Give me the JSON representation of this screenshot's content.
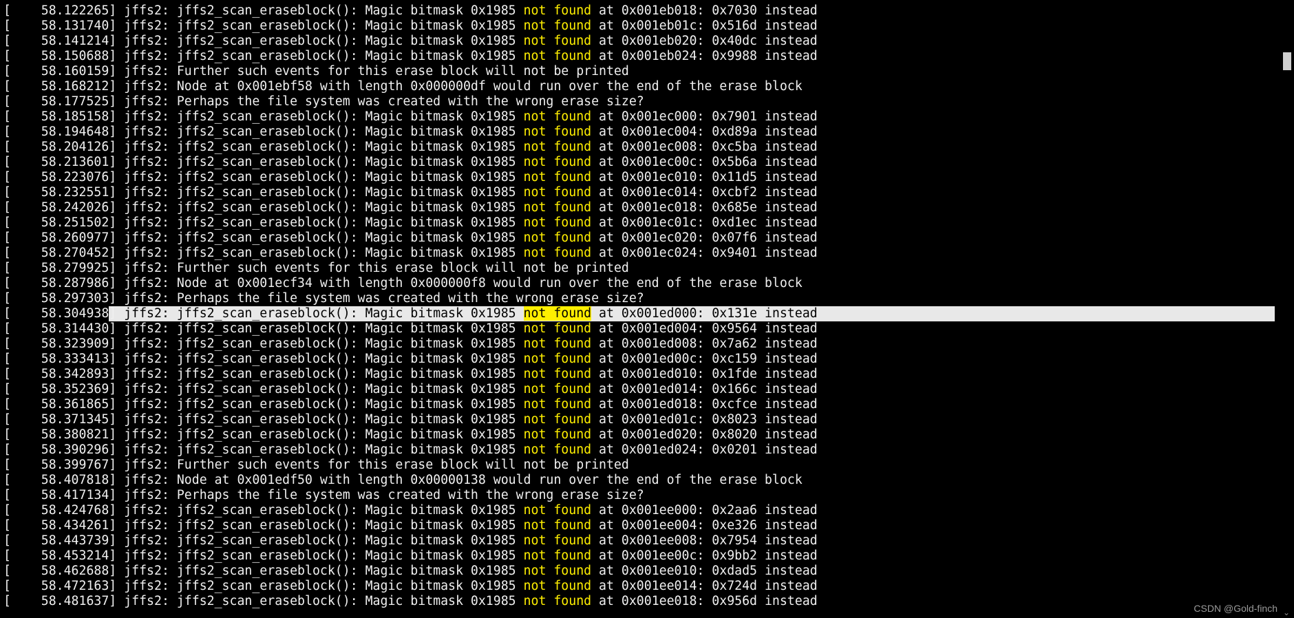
{
  "colors": {
    "background": "#000000",
    "text": "#f0f0f0",
    "highlight": "#ffef00",
    "selection": "#e8e8e8"
  },
  "highlight_word": "not found",
  "lines": [
    {
      "ts": "[    58.122265]",
      "msg": " jffs2: jffs2_scan_eraseblock(): Magic bitmask 0x1985 not found at 0x001eb018: 0x7030 instead"
    },
    {
      "ts": "[    58.131740]",
      "msg": " jffs2: jffs2_scan_eraseblock(): Magic bitmask 0x1985 not found at 0x001eb01c: 0x516d instead"
    },
    {
      "ts": "[    58.141214]",
      "msg": " jffs2: jffs2_scan_eraseblock(): Magic bitmask 0x1985 not found at 0x001eb020: 0x40dc instead"
    },
    {
      "ts": "[    58.150688]",
      "msg": " jffs2: jffs2_scan_eraseblock(): Magic bitmask 0x1985 not found at 0x001eb024: 0x9988 instead"
    },
    {
      "ts": "[    58.160159]",
      "msg": " jffs2: Further such events for this erase block will not be printed"
    },
    {
      "ts": "[    58.168212]",
      "msg": " jffs2: Node at 0x001ebf58 with length 0x000000df would run over the end of the erase block"
    },
    {
      "ts": "[    58.177525]",
      "msg": " jffs2: Perhaps the file system was created with the wrong erase size?"
    },
    {
      "ts": "[    58.185158]",
      "msg": " jffs2: jffs2_scan_eraseblock(): Magic bitmask 0x1985 not found at 0x001ec000: 0x7901 instead"
    },
    {
      "ts": "[    58.194648]",
      "msg": " jffs2: jffs2_scan_eraseblock(): Magic bitmask 0x1985 not found at 0x001ec004: 0xd89a instead"
    },
    {
      "ts": "[    58.204126]",
      "msg": " jffs2: jffs2_scan_eraseblock(): Magic bitmask 0x1985 not found at 0x001ec008: 0xc5ba instead"
    },
    {
      "ts": "[    58.213601]",
      "msg": " jffs2: jffs2_scan_eraseblock(): Magic bitmask 0x1985 not found at 0x001ec00c: 0x5b6a instead"
    },
    {
      "ts": "[    58.223076]",
      "msg": " jffs2: jffs2_scan_eraseblock(): Magic bitmask 0x1985 not found at 0x001ec010: 0x11d5 instead"
    },
    {
      "ts": "[    58.232551]",
      "msg": " jffs2: jffs2_scan_eraseblock(): Magic bitmask 0x1985 not found at 0x001ec014: 0xcbf2 instead"
    },
    {
      "ts": "[    58.242026]",
      "msg": " jffs2: jffs2_scan_eraseblock(): Magic bitmask 0x1985 not found at 0x001ec018: 0x685e instead"
    },
    {
      "ts": "[    58.251502]",
      "msg": " jffs2: jffs2_scan_eraseblock(): Magic bitmask 0x1985 not found at 0x001ec01c: 0xd1ec instead"
    },
    {
      "ts": "[    58.260977]",
      "msg": " jffs2: jffs2_scan_eraseblock(): Magic bitmask 0x1985 not found at 0x001ec020: 0x07f6 instead"
    },
    {
      "ts": "[    58.270452]",
      "msg": " jffs2: jffs2_scan_eraseblock(): Magic bitmask 0x1985 not found at 0x001ec024: 0x9401 instead"
    },
    {
      "ts": "[    58.279925]",
      "msg": " jffs2: Further such events for this erase block will not be printed"
    },
    {
      "ts": "[    58.287986]",
      "msg": " jffs2: Node at 0x001ecf34 with length 0x000000f8 would run over the end of the erase block"
    },
    {
      "ts": "[    58.297303]",
      "msg": " jffs2: Perhaps the file system was created with the wrong erase size?"
    },
    {
      "ts": "[    58.304938]",
      "msg": " jffs2: jffs2_scan_eraseblock(): Magic bitmask 0x1985 not found at 0x001ed000: 0x131e instead",
      "selected": true
    },
    {
      "ts": "[    58.314430]",
      "msg": " jffs2: jffs2_scan_eraseblock(): Magic bitmask 0x1985 not found at 0x001ed004: 0x9564 instead"
    },
    {
      "ts": "[    58.323909]",
      "msg": " jffs2: jffs2_scan_eraseblock(): Magic bitmask 0x1985 not found at 0x001ed008: 0x7a62 instead"
    },
    {
      "ts": "[    58.333413]",
      "msg": " jffs2: jffs2_scan_eraseblock(): Magic bitmask 0x1985 not found at 0x001ed00c: 0xc159 instead"
    },
    {
      "ts": "[    58.342893]",
      "msg": " jffs2: jffs2_scan_eraseblock(): Magic bitmask 0x1985 not found at 0x001ed010: 0x1fde instead"
    },
    {
      "ts": "[    58.352369]",
      "msg": " jffs2: jffs2_scan_eraseblock(): Magic bitmask 0x1985 not found at 0x001ed014: 0x166c instead"
    },
    {
      "ts": "[    58.361865]",
      "msg": " jffs2: jffs2_scan_eraseblock(): Magic bitmask 0x1985 not found at 0x001ed018: 0xcfce instead"
    },
    {
      "ts": "[    58.371345]",
      "msg": " jffs2: jffs2_scan_eraseblock(): Magic bitmask 0x1985 not found at 0x001ed01c: 0x8023 instead"
    },
    {
      "ts": "[    58.380821]",
      "msg": " jffs2: jffs2_scan_eraseblock(): Magic bitmask 0x1985 not found at 0x001ed020: 0x8020 instead"
    },
    {
      "ts": "[    58.390296]",
      "msg": " jffs2: jffs2_scan_eraseblock(): Magic bitmask 0x1985 not found at 0x001ed024: 0x0201 instead"
    },
    {
      "ts": "[    58.399767]",
      "msg": " jffs2: Further such events for this erase block will not be printed"
    },
    {
      "ts": "[    58.407818]",
      "msg": " jffs2: Node at 0x001edf50 with length 0x00000138 would run over the end of the erase block"
    },
    {
      "ts": "[    58.417134]",
      "msg": " jffs2: Perhaps the file system was created with the wrong erase size?"
    },
    {
      "ts": "[    58.424768]",
      "msg": " jffs2: jffs2_scan_eraseblock(): Magic bitmask 0x1985 not found at 0x001ee000: 0x2aa6 instead"
    },
    {
      "ts": "[    58.434261]",
      "msg": " jffs2: jffs2_scan_eraseblock(): Magic bitmask 0x1985 not found at 0x001ee004: 0xe326 instead"
    },
    {
      "ts": "[    58.443739]",
      "msg": " jffs2: jffs2_scan_eraseblock(): Magic bitmask 0x1985 not found at 0x001ee008: 0x7954 instead"
    },
    {
      "ts": "[    58.453214]",
      "msg": " jffs2: jffs2_scan_eraseblock(): Magic bitmask 0x1985 not found at 0x001ee00c: 0x9bb2 instead"
    },
    {
      "ts": "[    58.462688]",
      "msg": " jffs2: jffs2_scan_eraseblock(): Magic bitmask 0x1985 not found at 0x001ee010: 0xdad5 instead"
    },
    {
      "ts": "[    58.472163]",
      "msg": " jffs2: jffs2_scan_eraseblock(): Magic bitmask 0x1985 not found at 0x001ee014: 0x724d instead"
    },
    {
      "ts": "[    58.481637]",
      "msg": " jffs2: jffs2_scan_eraseblock(): Magic bitmask 0x1985 not found at 0x001ee018: 0x956d instead"
    }
  ],
  "watermark": "CSDN @Gold-finch",
  "scrollbar": {
    "down_arrow_icon": "chevron-down-icon",
    "scroll_position": 0.09
  }
}
